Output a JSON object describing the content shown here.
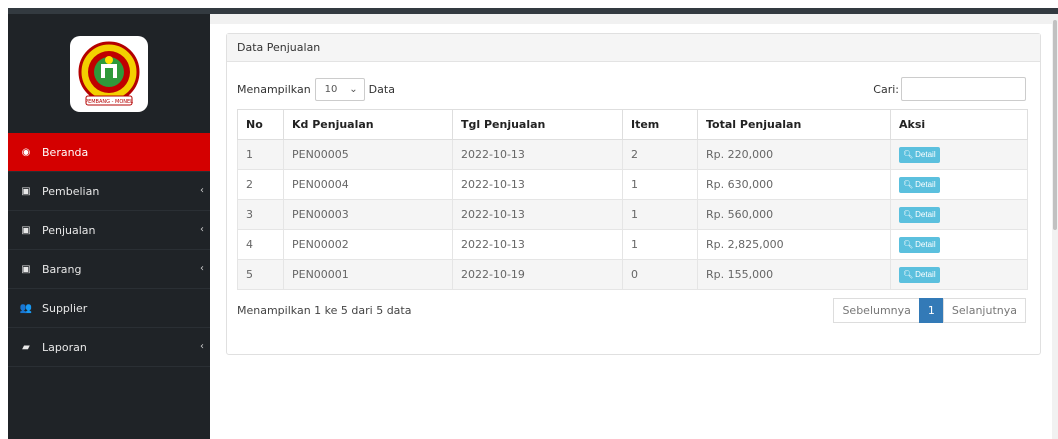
{
  "sidebar": {
    "logo_caption": "PEMBANG - MONEL",
    "items": [
      {
        "label": "Beranda",
        "icon": "tachometer-icon",
        "glyph": "◉",
        "has_submenu": false,
        "active": true
      },
      {
        "label": "Pembelian",
        "icon": "money-icon",
        "glyph": "▣",
        "has_submenu": true,
        "active": false
      },
      {
        "label": "Penjualan",
        "icon": "money-icon",
        "glyph": "▣",
        "has_submenu": true,
        "active": false
      },
      {
        "label": "Barang",
        "icon": "money-icon",
        "glyph": "▣",
        "has_submenu": true,
        "active": false
      },
      {
        "label": "Supplier",
        "icon": "users-icon",
        "glyph": "👥",
        "has_submenu": false,
        "active": false
      },
      {
        "label": "Laporan",
        "icon": "book-icon",
        "glyph": "▰",
        "has_submenu": true,
        "active": false
      }
    ]
  },
  "panel": {
    "title": "Data Penjualan",
    "length_prefix": "Menampilkan",
    "length_value": "10",
    "length_suffix": "Data",
    "search_label": "Cari:",
    "search_value": ""
  },
  "table": {
    "headers": [
      "No",
      "Kd Penjualan",
      "Tgl Penjualan",
      "Item",
      "Total Penjualan",
      "Aksi"
    ],
    "rows": [
      {
        "no": "1",
        "kd": "PEN00005",
        "tgl": "2022-10-13",
        "item": "2",
        "total": "Rp. 220,000",
        "aksi": "Detail"
      },
      {
        "no": "2",
        "kd": "PEN00004",
        "tgl": "2022-10-13",
        "item": "1",
        "total": "Rp. 630,000",
        "aksi": "Detail"
      },
      {
        "no": "3",
        "kd": "PEN00003",
        "tgl": "2022-10-13",
        "item": "1",
        "total": "Rp. 560,000",
        "aksi": "Detail"
      },
      {
        "no": "4",
        "kd": "PEN00002",
        "tgl": "2022-10-13",
        "item": "1",
        "total": "Rp. 2,825,000",
        "aksi": "Detail"
      },
      {
        "no": "5",
        "kd": "PEN00001",
        "tgl": "2022-10-19",
        "item": "0",
        "total": "Rp. 155,000",
        "aksi": "Detail"
      }
    ]
  },
  "footer": {
    "info": "Menampilkan 1 ke 5 dari 5 data",
    "prev": "Sebelumnya",
    "page": "1",
    "next": "Selanjutnya"
  },
  "colors": {
    "sidebar_bg": "#1f2327",
    "active_red": "#d40000",
    "detail_button": "#5bc0de",
    "pager_active": "#337ab7"
  }
}
